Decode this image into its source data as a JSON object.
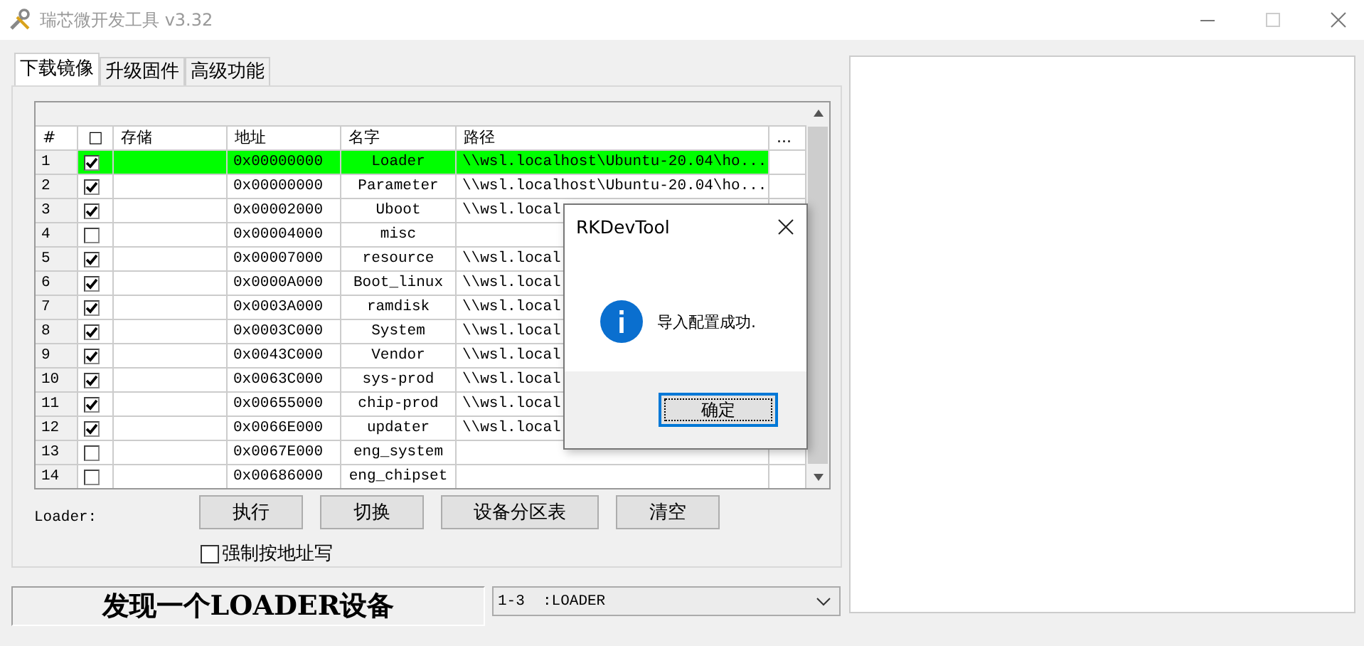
{
  "window": {
    "title": "瑞芯微开发工具 v3.32"
  },
  "tabs": [
    {
      "label": "下载镜像",
      "selected": true
    },
    {
      "label": "升级固件",
      "selected": false
    },
    {
      "label": "高级功能",
      "selected": false
    }
  ],
  "table": {
    "columns": [
      "#",
      "□",
      "存储",
      "地址",
      "名字",
      "路径",
      "..."
    ],
    "rows": [
      {
        "index": "1",
        "checked": true,
        "selected": true,
        "address": "0x00000000",
        "name": "Loader",
        "path": "\\\\wsl.localhost\\Ubuntu-20.04\\ho..."
      },
      {
        "index": "2",
        "checked": true,
        "selected": false,
        "address": "0x00000000",
        "name": "Parameter",
        "path": "\\\\wsl.localhost\\Ubuntu-20.04\\ho..."
      },
      {
        "index": "3",
        "checked": true,
        "selected": false,
        "address": "0x00002000",
        "name": "Uboot",
        "path": "\\\\wsl.local"
      },
      {
        "index": "4",
        "checked": false,
        "selected": false,
        "address": "0x00004000",
        "name": "misc"
      },
      {
        "index": "5",
        "checked": true,
        "selected": false,
        "address": "0x00007000",
        "name": "resource",
        "path": "\\\\wsl.local"
      },
      {
        "index": "6",
        "checked": true,
        "selected": false,
        "address": "0x0000A000",
        "name": "Boot_linux",
        "path": "\\\\wsl.local"
      },
      {
        "index": "7",
        "checked": true,
        "selected": false,
        "address": "0x0003A000",
        "name": "ramdisk",
        "path": "\\\\wsl.local"
      },
      {
        "index": "8",
        "checked": true,
        "selected": false,
        "address": "0x0003C000",
        "name": "System",
        "path": "\\\\wsl.local"
      },
      {
        "index": "9",
        "checked": true,
        "selected": false,
        "address": "0x0043C000",
        "name": "Vendor",
        "path": "\\\\wsl.local"
      },
      {
        "index": "10",
        "checked": true,
        "selected": false,
        "address": "0x0063C000",
        "name": "sys-prod",
        "path": "\\\\wsl.local"
      },
      {
        "index": "11",
        "checked": true,
        "selected": false,
        "address": "0x00655000",
        "name": "chip-prod",
        "path": "\\\\wsl.local"
      },
      {
        "index": "12",
        "checked": true,
        "selected": false,
        "address": "0x0066E000",
        "name": "updater",
        "path": "\\\\wsl.local"
      },
      {
        "index": "13",
        "checked": false,
        "selected": false,
        "address": "0x0067E000",
        "name": "eng_system"
      },
      {
        "index": "14",
        "checked": false,
        "selected": false,
        "address": "0x00686000",
        "name": "eng_chipset"
      }
    ]
  },
  "loader_label": "Loader:",
  "buttons": [
    "执行",
    "切换",
    "设备分区表",
    "清空"
  ],
  "force_write": {
    "label": "强制按地址写",
    "checked": false
  },
  "status": "发现一个LOADER设备",
  "device_select": {
    "value": "1-3  :LOADER"
  },
  "dialog": {
    "title": "RKDevTool",
    "message": "导入配置成功.",
    "button": "确定"
  }
}
